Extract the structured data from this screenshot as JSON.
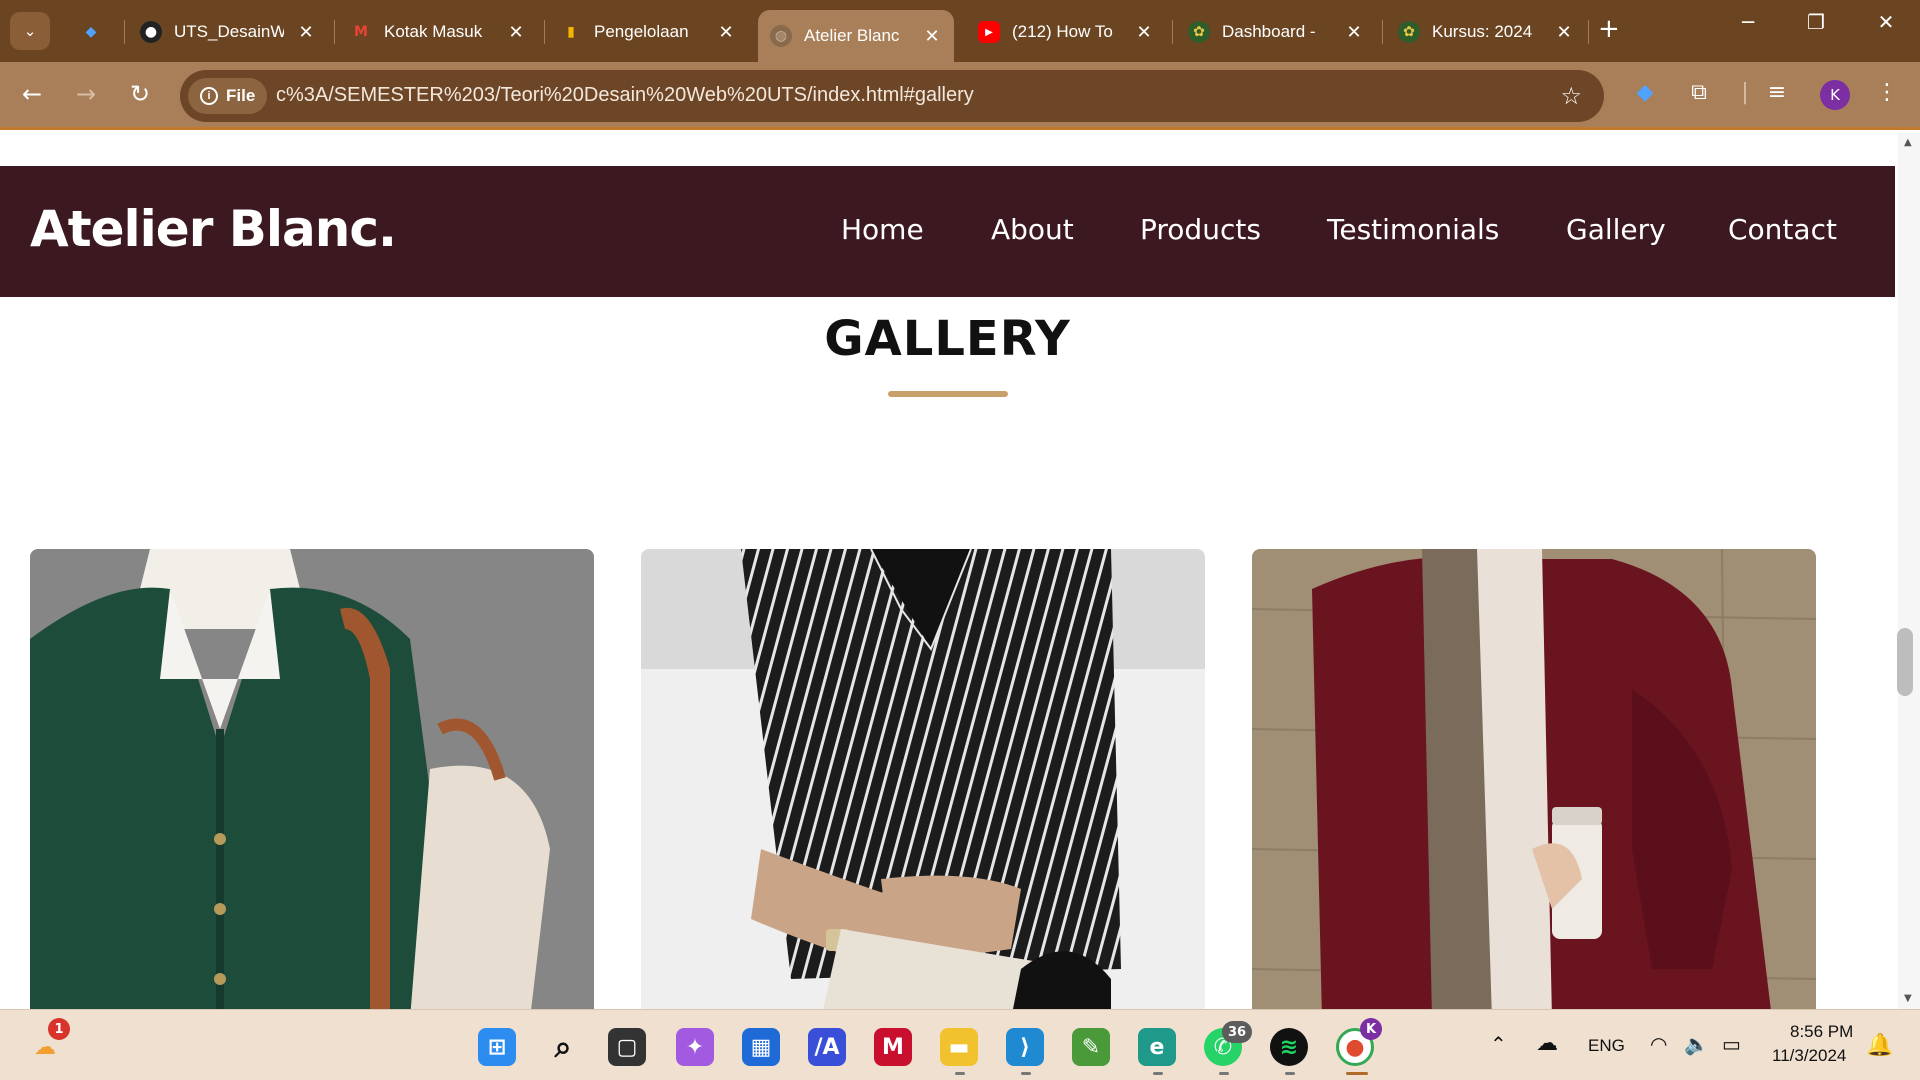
{
  "browser": {
    "tabs": [
      {
        "title": "",
        "icon": "gem-icon",
        "active": false
      },
      {
        "title": "UTS_DesainW",
        "icon": "github-icon",
        "active": false
      },
      {
        "title": "Kotak Masuk",
        "icon": "gmail-icon",
        "active": false
      },
      {
        "title": "Pengelolaan",
        "icon": "analytics-icon",
        "active": false
      },
      {
        "title": "Atelier Blanc",
        "icon": "globe-icon",
        "active": true
      },
      {
        "title": "(212) How To",
        "icon": "youtube-icon",
        "active": false
      },
      {
        "title": "Dashboard -",
        "icon": "moodle-icon",
        "active": false
      },
      {
        "title": "Kursus: 2024",
        "icon": "moodle-icon",
        "active": false
      }
    ],
    "address": {
      "chip_label": "File",
      "url": "c%3A/SEMESTER%203/Teori%20Desain%20Web%20UTS/index.html#gallery"
    },
    "profile_initial": "K"
  },
  "site": {
    "logo": "Atelier Blanc.",
    "nav": [
      "Home",
      "About",
      "Products",
      "Testimonials",
      "Gallery",
      "Contact"
    ],
    "gallery_heading": "GALLERY",
    "colors": {
      "nav_bg": "#3c1820",
      "accent": "#c8a16a"
    },
    "gallery_items": [
      {
        "subject": "green cable-knit cardigan with white collar and tan bag"
      },
      {
        "subject": "black and white striped shirt with watch"
      },
      {
        "subject": "burgundy knit cardigan with scarf and coffee cup"
      }
    ]
  },
  "taskbar": {
    "weather_badge": "1",
    "whatsapp_badge": "36",
    "chrome_badge": "K",
    "language": "ENG",
    "time": "8:56 PM",
    "date": "11/3/2024"
  }
}
